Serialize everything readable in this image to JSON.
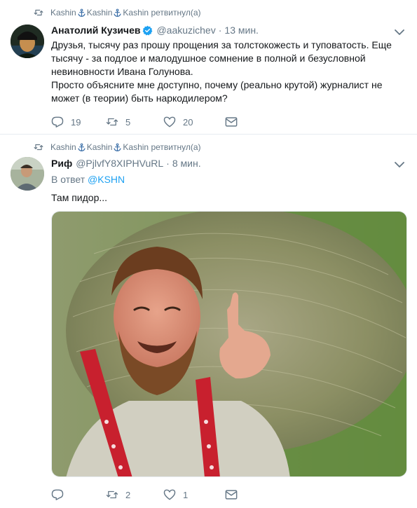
{
  "tweets": [
    {
      "retweet": {
        "names": [
          "Kashin",
          "Kashin",
          "Kashin"
        ],
        "suffix": "ретвитнул(а)"
      },
      "author": {
        "name": "Анатолий Кузичев",
        "handle": "@aakuzichev",
        "verified": true
      },
      "time": "13 мин.",
      "paragraphs": [
        "Друзья, тысячу раз прошу прощения за толстокожесть и туповатость. Еще тысячу - за подлое и малодушное сомнение в полной и безусловной невиновности Ивана Голунова.",
        "Просто объясните мне доступно, почему (реально крутой) журналист не может (в теории) быть наркодилером?"
      ],
      "counts": {
        "replies": "19",
        "retweets": "5",
        "likes": "20"
      }
    },
    {
      "retweet": {
        "names": [
          "Kashin",
          "Kashin",
          "Kashin"
        ],
        "suffix": "ретвитнул(а)"
      },
      "author": {
        "name": "Риф",
        "handle": "@PjlvfY8XIPHVuRL",
        "verified": false
      },
      "time": "8 мин.",
      "reply_to": {
        "prefix": "В ответ",
        "handle": "@KSHN"
      },
      "text": "Там пидор...",
      "counts": {
        "replies": "",
        "retweets": "2",
        "likes": "1"
      }
    }
  ],
  "colors": {
    "accent": "#1da1f2",
    "secondary_text": "#657786",
    "primary_text": "#14171a",
    "divider": "#e6ecf0"
  },
  "icons": [
    "retweet-icon",
    "anchor-icon",
    "verified-badge-icon",
    "chevron-down-icon",
    "reply-icon",
    "heart-icon",
    "envelope-icon"
  ]
}
